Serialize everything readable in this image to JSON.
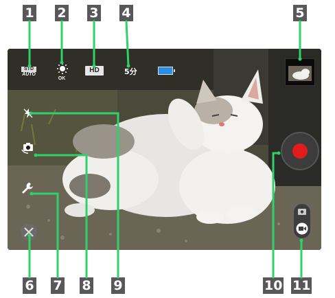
{
  "callouts": [
    "1",
    "2",
    "3",
    "4",
    "5",
    "6",
    "7",
    "8",
    "9",
    "10",
    "11"
  ],
  "status_bar": {
    "std_label": "STD",
    "std_sub_label": "AUTO",
    "wb_label": "OK",
    "resolution": "HD",
    "remaining_time": "5分"
  },
  "controls": {
    "record_color": "#e21c1c"
  },
  "icons": {
    "std": "scene-mode-icon",
    "wb": "white-balance-icon",
    "battery": "battery-icon",
    "thumbnail": "last-shot-thumbnail",
    "settings": "settings-icon",
    "wrench": "wrench-icon",
    "camera_switch": "camera-switch-icon",
    "flash": "flash-icon",
    "record": "record-button",
    "mode": "camera-video-mode-switch"
  }
}
